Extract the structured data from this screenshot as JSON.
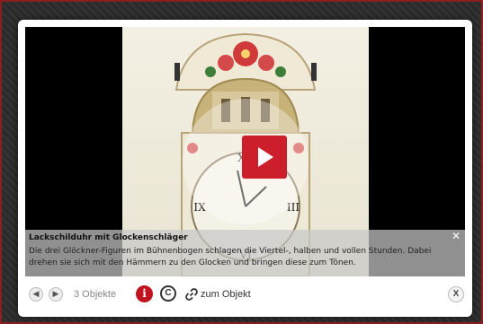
{
  "media": {
    "play_icon": "play-icon"
  },
  "caption": {
    "title": "Lackschilduhr mit Glockenschläger",
    "text": "Die drei Glöckner-Figuren im Bühnenbogen schlagen die Viertel-, halben und vollen Stunden. Dabei drehen sie sich mit den Hämmern zu den Glocken und bringen diese zum Tönen.",
    "close_glyph": "✕"
  },
  "footer": {
    "prev_glyph": "◀",
    "next_glyph": "▶",
    "count_label": "3 Objekte",
    "info_glyph": "i",
    "copyright_glyph": "C",
    "link_label": "zum Objekt",
    "close_glyph": "X"
  },
  "colors": {
    "accent": "#cc1f2b",
    "info": "#c1121f"
  }
}
